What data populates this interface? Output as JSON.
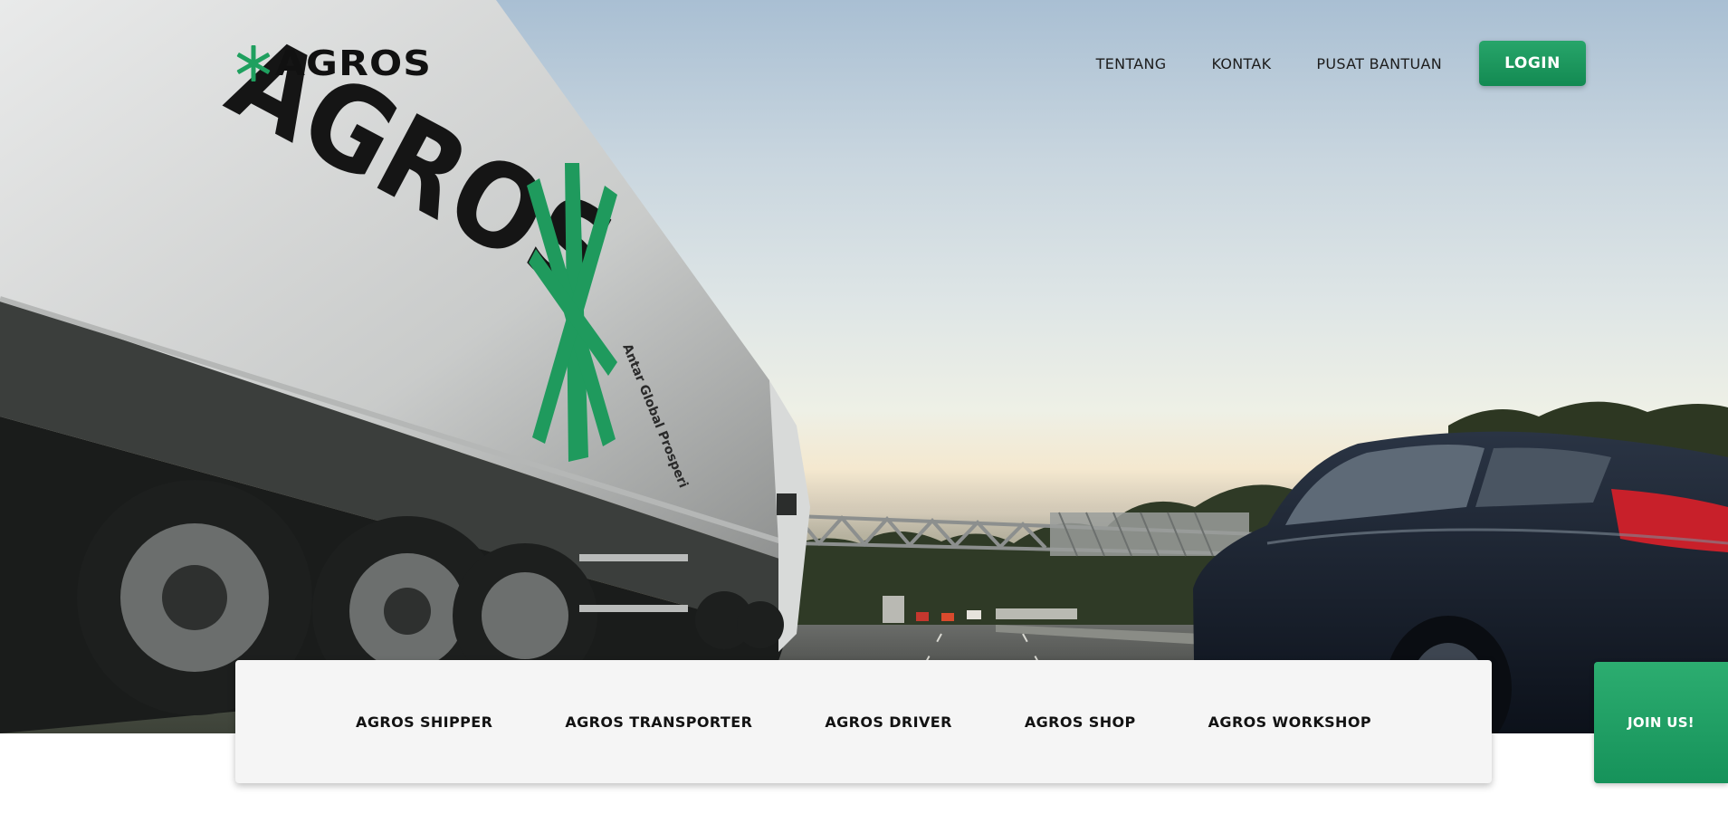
{
  "brand": {
    "name": "AGROS",
    "accent": "#1e9a60"
  },
  "truck": {
    "brand_text": "AGROS",
    "tagline": "Antar Global Prosperi"
  },
  "nav": {
    "items": [
      {
        "label": "TENTANG"
      },
      {
        "label": "KONTAK"
      },
      {
        "label": "PUSAT BANTUAN"
      }
    ],
    "login_label": "LOGIN"
  },
  "products": [
    {
      "label": "AGROS SHIPPER"
    },
    {
      "label": "AGROS TRANSPORTER"
    },
    {
      "label": "AGROS DRIVER"
    },
    {
      "label": "AGROS SHOP"
    },
    {
      "label": "AGROS WORKSHOP"
    }
  ],
  "join": {
    "label": "JOIN US!"
  }
}
